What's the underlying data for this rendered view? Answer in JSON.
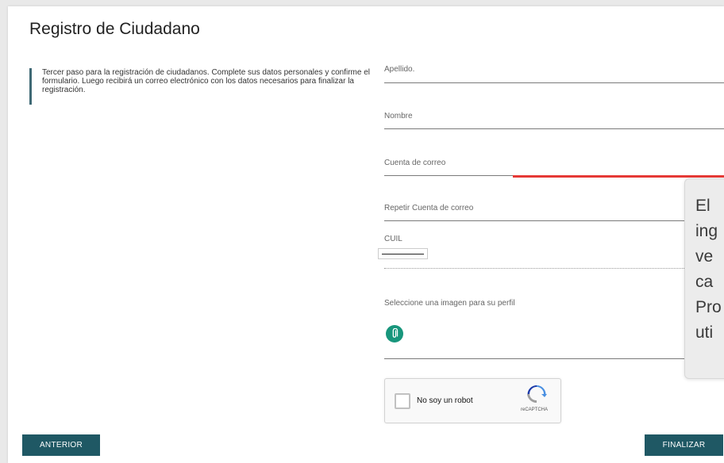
{
  "page": {
    "title": "Registro de Ciudadano",
    "info": "Tercer paso para la registración de ciudadanos. Complete sus datos personales y confirme el formulario. Luego recibirá un correo electrónico con los datos necesarios para finalizar la registración."
  },
  "form": {
    "apellido_label": "Apellido.",
    "nombre_label": "Nombre",
    "email_label": "Cuenta de correo",
    "email_repeat_label": "Repetir Cuenta de correo",
    "cuil_label": "CUIL",
    "image_label": "Seleccione una imagen para su perfil"
  },
  "captcha": {
    "label": "No soy un robot",
    "brand": "reCAPTCHA"
  },
  "buttons": {
    "prev": "ANTERIOR",
    "next": "FINALIZAR"
  },
  "tooltip": {
    "lines": [
      "El",
      "ing",
      "ve",
      "ca",
      "Pro",
      "uti"
    ]
  },
  "colors": {
    "accent": "#1f5864",
    "error": "#e53935",
    "attach_icon": "#18967c"
  },
  "icons": {
    "attach": "paperclip-icon",
    "captcha": "recaptcha-icon"
  }
}
